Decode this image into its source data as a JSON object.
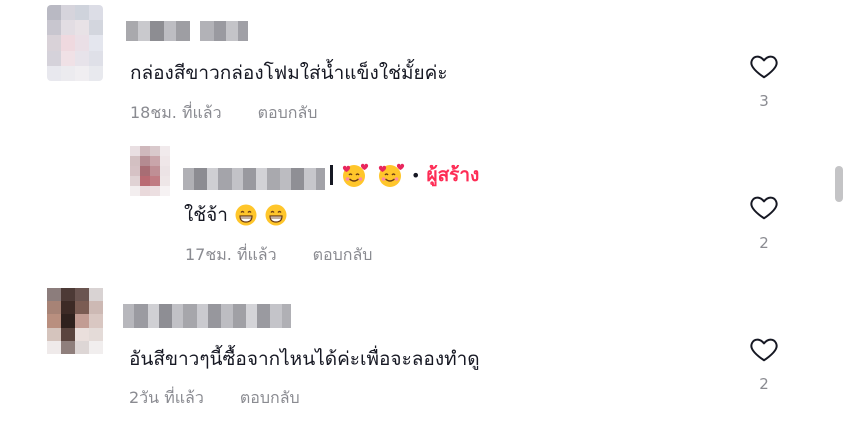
{
  "comments": [
    {
      "text": "กล่องสีขาวกล่องโฟมใส่น้ำแข็งใช่มั้ยค่ะ",
      "time": "18ชม. ที่แล้ว",
      "reply_label": "ตอบกลับ",
      "likes": "3"
    },
    {
      "text": "ใช้จ้า",
      "time": "17ชม. ที่แล้ว",
      "reply_label": "ตอบกลับ",
      "likes": "2",
      "creator_badge": "ผู้สร้าง"
    },
    {
      "text": "อันสีขาวๆนี้ซื้อจากไหนได้ค่ะเพื่อจะลองทำดู",
      "time": "2วัน ที่แล้ว",
      "reply_label": "ตอบกลับ",
      "likes": "2"
    }
  ],
  "icons": {
    "like": "heart-outline-icon",
    "emoji_love": "smiling-face-with-hearts-emoji",
    "emoji_grin": "grinning-face-emoji"
  },
  "colors": {
    "accent": "#fe2c55",
    "text": "#161823",
    "muted": "#8a8b91"
  }
}
